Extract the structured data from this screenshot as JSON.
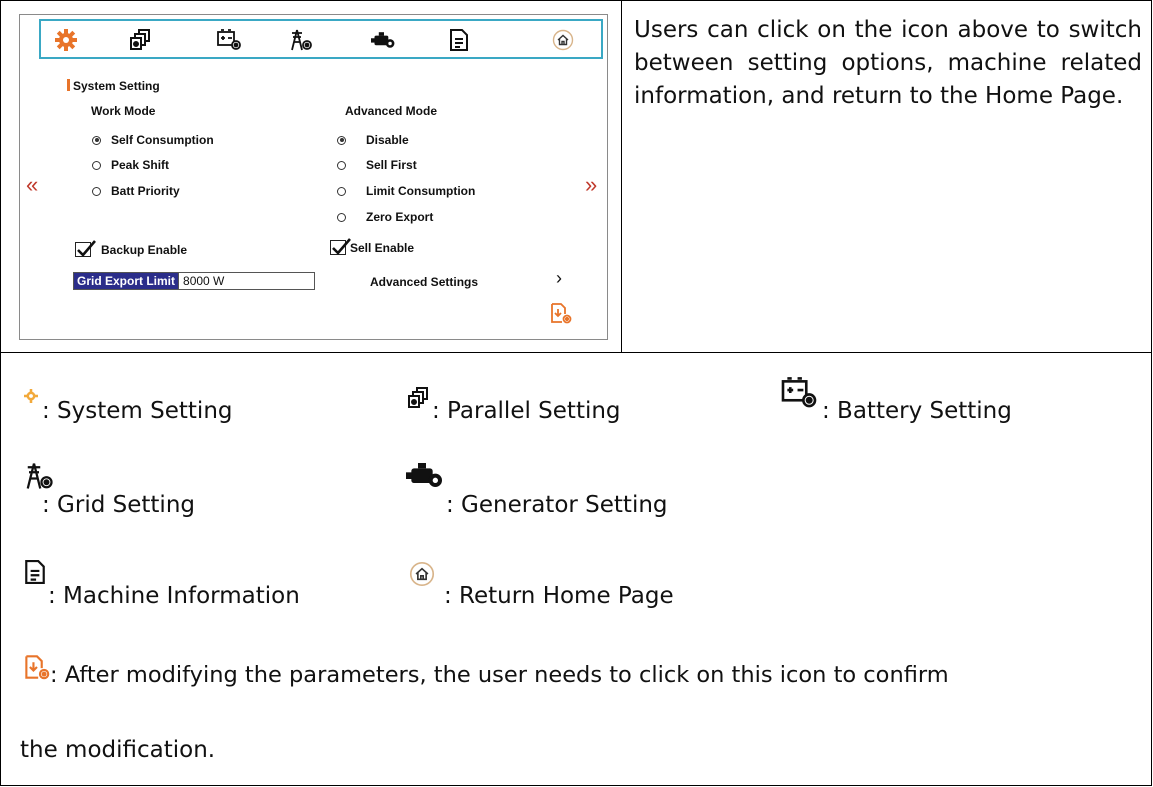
{
  "screen": {
    "tabs": [
      {
        "name": "system-setting",
        "icon": "gear-icon"
      },
      {
        "name": "parallel-setting",
        "icon": "parallel-icon"
      },
      {
        "name": "battery-setting",
        "icon": "battery-gear-icon"
      },
      {
        "name": "grid-setting",
        "icon": "grid-tower-icon"
      },
      {
        "name": "generator-setting",
        "icon": "generator-icon"
      },
      {
        "name": "machine-information",
        "icon": "document-icon"
      },
      {
        "name": "home",
        "icon": "home-icon"
      }
    ],
    "section_title": "System Setting",
    "work_mode": {
      "heading": "Work Mode",
      "options": [
        "Self Consumption",
        "Peak Shift",
        "Batt Priority"
      ],
      "selected": "Self Consumption"
    },
    "advanced_mode": {
      "heading": "Advanced Mode",
      "options": [
        "Disable",
        "Sell First",
        "Limit Consumption",
        "Zero Export"
      ],
      "selected": "Disable"
    },
    "prev_arrow": "«",
    "next_arrow": "»",
    "backup_enable": {
      "label": "Backup Enable",
      "checked": true
    },
    "sell_enable": {
      "label": "Sell Enable",
      "checked": true
    },
    "grid_export_limit": {
      "label": "Grid Export Limit",
      "value": "8000 W"
    },
    "advanced_settings": "Advanced Settings",
    "chevron": "›",
    "accent_color": "#e8742a",
    "tabbar_border_color": "#3aa8c4",
    "label_bg_color": "#2b2d8a"
  },
  "description": "Users can click on the icon above to switch between setting options, machine related information, and return to the Home Page.",
  "legend": {
    "system": ": System Setting",
    "parallel": ": Parallel Setting",
    "battery": ": Battery Setting",
    "grid": ": Grid Setting",
    "generator": ": Generator Setting",
    "machine": ": Machine Information",
    "home": ": Return Home Page",
    "confirm_line1": ": After modifying the parameters, the user needs to click on this icon to confirm",
    "confirm_line2": "the modification."
  }
}
